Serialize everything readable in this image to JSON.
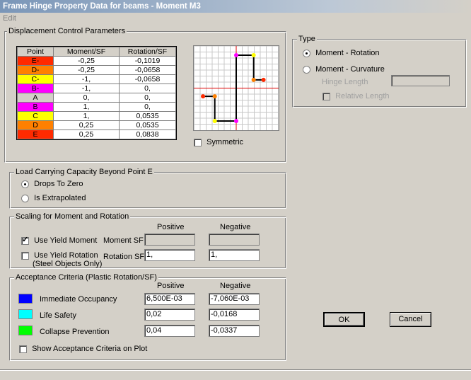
{
  "window": {
    "title": "Frame Hinge Property Data for beams - Moment M3"
  },
  "menu": {
    "edit": "Edit"
  },
  "displacement": {
    "legend": "Displacement Control Parameters",
    "headers": [
      "Point",
      "Moment/SF",
      "Rotation/SF"
    ],
    "rows": [
      {
        "point": "E-",
        "moment": "-0,25",
        "rotation": "-0,1019",
        "color": "#ff2a00"
      },
      {
        "point": "D-",
        "moment": "-0,25",
        "rotation": "-0,0658",
        "color": "#ff8000"
      },
      {
        "point": "C-",
        "moment": "-1,",
        "rotation": "-0,0658",
        "color": "#ffff00"
      },
      {
        "point": "B-",
        "moment": "-1,",
        "rotation": "0,",
        "color": "#ff00ff"
      },
      {
        "point": "A",
        "moment": "0,",
        "rotation": "0,",
        "color": "#d4d0c8"
      },
      {
        "point": "B",
        "moment": "1,",
        "rotation": "0,",
        "color": "#ff00ff"
      },
      {
        "point": "C",
        "moment": "1,",
        "rotation": "0,0535",
        "color": "#ffff00"
      },
      {
        "point": "D",
        "moment": "0,25",
        "rotation": "0,0535",
        "color": "#ff8000"
      },
      {
        "point": "E",
        "moment": "0,25",
        "rotation": "0,0838",
        "color": "#ff2a00"
      }
    ],
    "symmetric_label": "Symmetric"
  },
  "type": {
    "legend": "Type",
    "moment_rotation": "Moment - Rotation",
    "moment_curvature": "Moment - Curvature",
    "hinge_length": "Hinge Length",
    "relative_length": "Relative Length"
  },
  "load_capacity": {
    "legend": "Load Carrying Capacity Beyond Point E",
    "drops_to_zero": "Drops To Zero",
    "is_extrapolated": "Is Extrapolated"
  },
  "scaling": {
    "legend": "Scaling for Moment and Rotation",
    "positive": "Positive",
    "negative": "Negative",
    "use_yield_moment": "Use Yield Moment",
    "moment_sf": "Moment SF",
    "use_yield_rotation": "Use Yield Rotation",
    "steel_only": "(Steel Objects Only)",
    "rotation_sf": "Rotation SF",
    "rotation_pos": "1,",
    "rotation_neg": "1,"
  },
  "acceptance": {
    "legend": "Acceptance Criteria (Plastic Rotation/SF)",
    "positive": "Positive",
    "negative": "Negative",
    "io_label": "Immediate Occupancy",
    "io_color": "#0000ff",
    "io_pos": "6,500E-03",
    "io_neg": "-7,060E-03",
    "ls_label": "Life Safety",
    "ls_color": "#00ffff",
    "ls_pos": "0,02",
    "ls_neg": "-0,0168",
    "cp_label": "Collapse Prevention",
    "cp_color": "#00ff00",
    "cp_pos": "0,04",
    "cp_neg": "-0,0337",
    "show_on_plot": "Show Acceptance Criteria on Plot"
  },
  "buttons": {
    "ok": "OK",
    "cancel": "Cancel"
  }
}
